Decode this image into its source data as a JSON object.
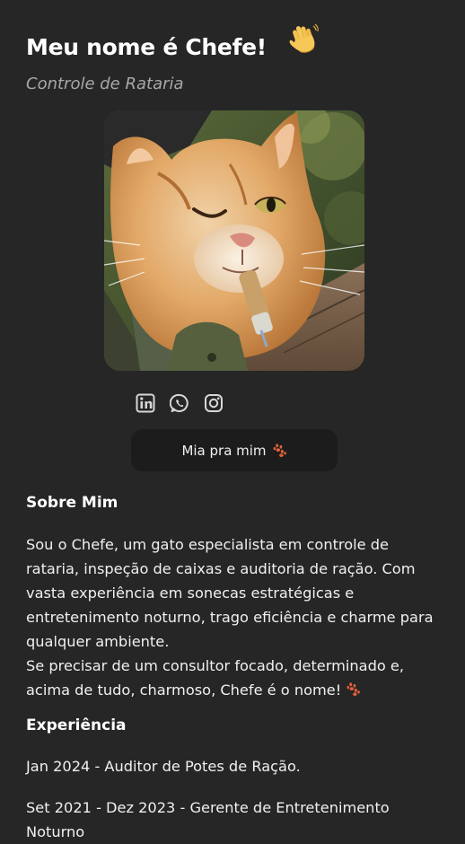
{
  "header": {
    "title": "Meu nome é Chefe!",
    "subtitle": "Controle de Rataria"
  },
  "icons": {
    "wave": "waving-hand-icon",
    "linkedin": "linkedin-icon",
    "whatsapp": "whatsapp-icon",
    "instagram": "instagram-icon",
    "paw": "paw-icon"
  },
  "cta": {
    "label": "Mia pra mim"
  },
  "about": {
    "heading": "Sobre Mim",
    "paragraph1": "Sou o Chefe, um gato especialista em controle de rataria, inspeção de caixas e auditoria de ração. Com vasta experiência em sonecas estratégicas e entretenimento noturno, trago eficiência e charme para qualquer ambiente.",
    "paragraph2": "Se precisar de um consultor focado, determinado e, acima de tudo, charmoso, Chefe é o nome!"
  },
  "experience": {
    "heading": "Experiência",
    "items": [
      "Jan 2024 - Auditor de Potes de Ração.",
      "Set 2021 - Dez 2023 - Gerente de Entretenimento Noturno"
    ]
  },
  "colors": {
    "background": "#262626",
    "button": "#1c1c1c",
    "text": "#f0f0f0",
    "subtitle": "#a8a8a8",
    "paw": "#e0603a"
  }
}
